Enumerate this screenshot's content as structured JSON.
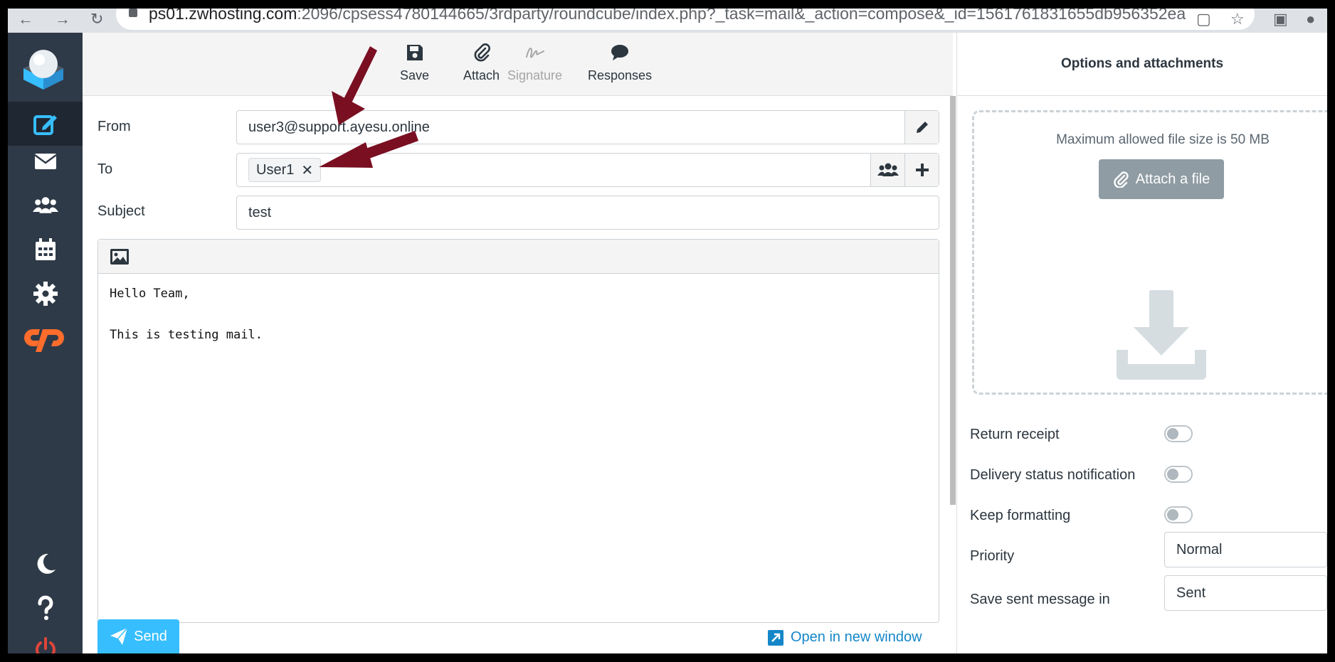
{
  "browser": {
    "url_host": "ps01.zwhosting.com",
    "url_rest": ":2096/cpsess4780144665/3rdparty/roundcube/index.php?_task=mail&_action=compose&_id=1561761831655db956352ea"
  },
  "toolbar": {
    "save": "Save",
    "attach": "Attach",
    "signature": "Signature",
    "responses": "Responses"
  },
  "compose": {
    "from_label": "From",
    "from_value": "user3@support.ayesu.online",
    "to_label": "To",
    "to_recipient": "User1",
    "to_remove": "✕",
    "subject_label": "Subject",
    "subject_value": "test",
    "body_line1": "Hello Team,",
    "body_line2": "",
    "body_line3": "This is testing mail."
  },
  "footer": {
    "send": "Send",
    "open_new_window": "Open in new window"
  },
  "options": {
    "title": "Options and attachments",
    "max_size": "Maximum allowed file size is 50 MB",
    "attach_file": "Attach a file",
    "return_receipt": "Return receipt",
    "delivery_status": "Delivery status notification",
    "keep_formatting": "Keep formatting",
    "priority_label": "Priority",
    "priority_value": "Normal",
    "save_sent_label": "Save sent message in",
    "save_sent_value": "Sent"
  },
  "colors": {
    "sidebar": "#2f3a48",
    "accent": "#37beff",
    "link": "#1586c8",
    "annotation_arrow": "#7a0f22",
    "cpanel": "#ff6c2c"
  }
}
